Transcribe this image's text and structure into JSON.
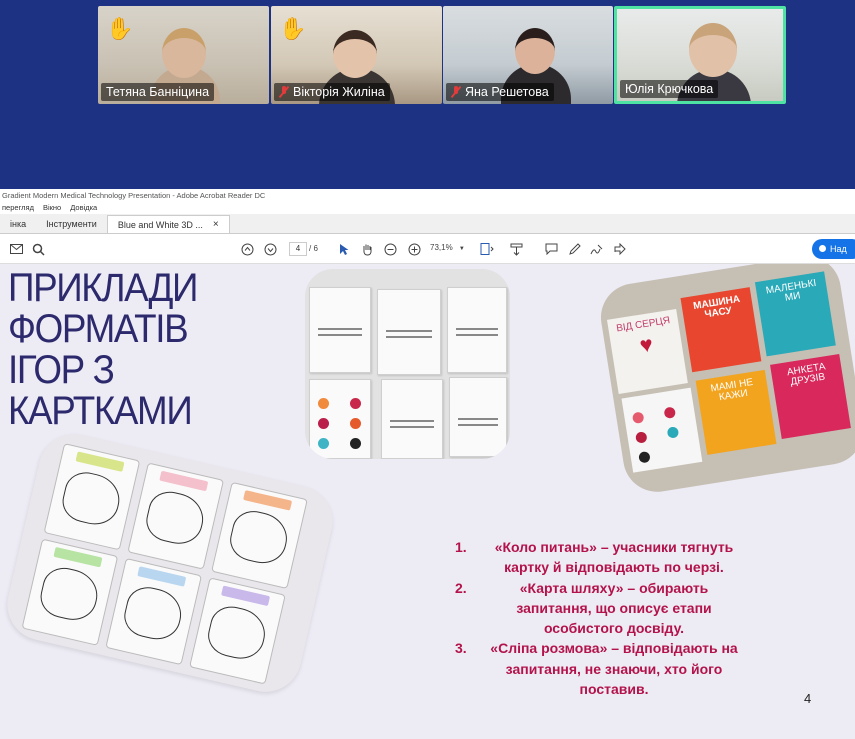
{
  "meeting": {
    "participants": [
      {
        "name": "Тетяна Банніцина",
        "hand_raised": true,
        "muted": false
      },
      {
        "name": "Вікторія Жиліна",
        "hand_raised": true,
        "muted": true
      },
      {
        "name": "Яна Решетова",
        "hand_raised": false,
        "muted": true
      },
      {
        "name": "Юлія Крючкова",
        "hand_raised": false,
        "muted": false,
        "active_speaker": true
      }
    ],
    "background_color": "#1d3282",
    "active_border_color": "#4fe3a3"
  },
  "acrobat": {
    "window_title": "Gradient Modern Medical Technology Presentation - Adobe Acrobat Reader DC",
    "menu": [
      "перегляд",
      "Вікно",
      "Довідка"
    ],
    "tabs": [
      {
        "label": "інка"
      },
      {
        "label": "Інструменти"
      },
      {
        "label": "Blue and White 3D ...",
        "active": true,
        "close": "×"
      }
    ],
    "toolbar": {
      "icons": [
        "email-icon",
        "search-icon",
        "page-up-icon",
        "page-down-icon",
        "select-cursor-icon",
        "hand-icon",
        "zoom-out-icon",
        "zoom-in-icon",
        "fit-page-icon",
        "scroll-mode-icon",
        "comment-icon",
        "pen-icon",
        "sign-icon",
        "share-link-icon"
      ],
      "current_page": "4",
      "total_pages": "/ 6",
      "zoom": "73,1%",
      "share_label": "Над"
    }
  },
  "slide": {
    "title_lines": [
      "ПРИКЛАДИ",
      "ФОРМАТІВ",
      "ІГОР З",
      "КАРТКАМИ"
    ],
    "title_color": "#2c2a6c",
    "rules": [
      {
        "num": "1.",
        "text": "«Коло питань» – учасники тягнуть картку й відповідають по черзі."
      },
      {
        "num": "2.",
        "text": "«Карта шляху» – обирають запитання, що описує етапи особистого досвіду."
      },
      {
        "num": "3.",
        "text": "«Сліпа розмова» – відповідають на запитання, не знаючи, хто його поставив."
      }
    ],
    "rules_color": "#b3134a",
    "page_number": "4",
    "photo2_cards": [
      "ВІД СЕРЦЯ",
      "МАШИНА ЧАСУ",
      "МАЛЕНЬКІ МИ",
      "МАМІ НЕ КАЖИ",
      "АНКЕТА ДРУЗІВ"
    ]
  }
}
